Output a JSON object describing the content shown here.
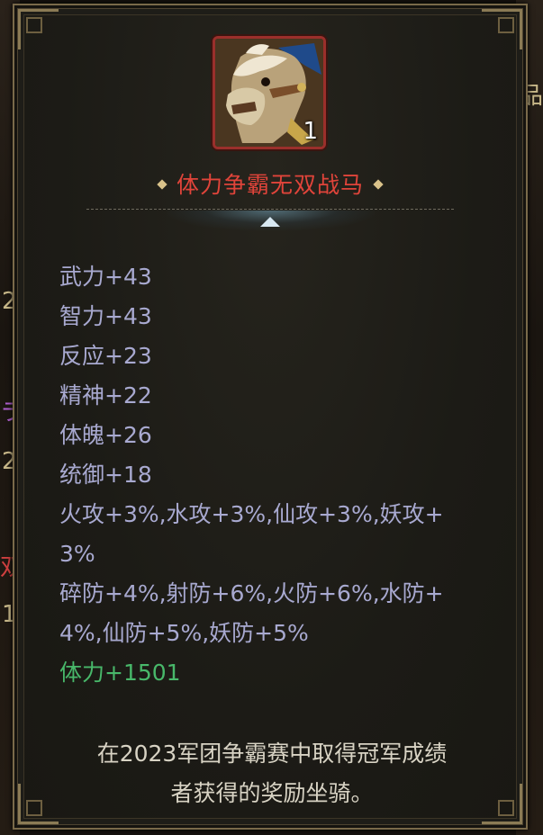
{
  "background": {
    "peek_right": "品",
    "peek_left": [
      "2",
      "ラ",
      "2",
      "双",
      "1"
    ]
  },
  "item": {
    "icon": "war-horse-icon",
    "count": "1",
    "name": "体力争霸无双战马",
    "name_color": "#e0443a"
  },
  "stats": [
    "武力+43",
    "智力+43",
    "反应+23",
    "精神+22",
    "体魄+26",
    "统御+18",
    "火攻+3%,水攻+3%,仙攻+3%,妖攻+",
    "3%",
    "碎防+4%,射防+6%,火防+6%,水防+",
    "4%,仙防+5%,妖防+5%"
  ],
  "special_stat": "体力+1501",
  "special_stat_color": "#48b86a",
  "description": {
    "line1": "在2023军团争霸赛中取得冠军成绩",
    "line2": "者获得的奖励坐骑。"
  }
}
